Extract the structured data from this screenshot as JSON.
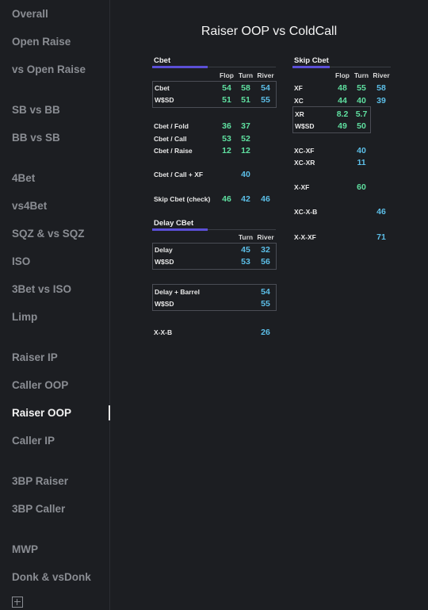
{
  "sidebar": {
    "items": [
      {
        "label": "Overall",
        "active": false
      },
      {
        "label": "Open Raise",
        "active": false
      },
      {
        "label": "vs Open Raise",
        "active": false
      },
      {
        "label": "SB vs BB",
        "active": false
      },
      {
        "label": "BB vs SB",
        "active": false
      },
      {
        "label": "4Bet",
        "active": false
      },
      {
        "label": "vs4Bet",
        "active": false
      },
      {
        "label": "SQZ & vs SQZ",
        "active": false
      },
      {
        "label": "ISO",
        "active": false
      },
      {
        "label": "3Bet vs ISO",
        "active": false
      },
      {
        "label": "Limp",
        "active": false
      },
      {
        "label": "Raiser IP",
        "active": false
      },
      {
        "label": "Caller OOP",
        "active": false
      },
      {
        "label": "Raiser OOP",
        "active": true
      },
      {
        "label": "Caller IP",
        "active": false
      },
      {
        "label": "3BP Raiser",
        "active": false
      },
      {
        "label": "3BP Caller",
        "active": false
      },
      {
        "label": "MWP",
        "active": false
      },
      {
        "label": "Donk & vsDonk",
        "active": false
      }
    ],
    "bottom_icon": "expand-icon"
  },
  "title": "Raiser OOP vs ColdCall",
  "colors": {
    "accent": "#5b4fd6",
    "green": "#5fe0a0",
    "blue": "#5cbfe8",
    "background": "#1c1e22"
  },
  "cbet": {
    "heading": "Cbet",
    "headers": [
      "Flop",
      "Turn",
      "River"
    ],
    "rows": [
      {
        "label": "Cbet",
        "values": [
          "54",
          "58",
          "54"
        ]
      },
      {
        "label": "W$SD",
        "values": [
          "51",
          "51",
          "55"
        ]
      },
      {
        "label": "Cbet / Fold",
        "values": [
          "36",
          "37",
          ""
        ]
      },
      {
        "label": "Cbet / Call",
        "values": [
          "53",
          "52",
          ""
        ]
      },
      {
        "label": "Cbet / Raise",
        "values": [
          "12",
          "12",
          ""
        ]
      },
      {
        "label": "Cbet / Call + XF",
        "values": [
          "",
          "40",
          ""
        ]
      },
      {
        "label": "Skip Cbet (check)",
        "values": [
          "46",
          "42",
          "46"
        ]
      }
    ]
  },
  "delay": {
    "heading": "Delay CBet",
    "headers": [
      "Turn",
      "River"
    ],
    "rows": [
      {
        "label": "Delay",
        "values": [
          "45",
          "32"
        ]
      },
      {
        "label": "W$SD",
        "values": [
          "53",
          "56"
        ]
      },
      {
        "label": "Delay + Barrel",
        "values": [
          "",
          "54"
        ]
      },
      {
        "label": "W$SD",
        "values": [
          "",
          "55"
        ]
      },
      {
        "label": "X-X-B",
        "values": [
          "",
          "26"
        ]
      }
    ]
  },
  "skip": {
    "heading": "Skip Cbet",
    "headers": [
      "Flop",
      "Turn",
      "River"
    ],
    "rows": [
      {
        "label": "XF",
        "values": [
          "48",
          "55",
          "58"
        ]
      },
      {
        "label": "XC",
        "values": [
          "44",
          "40",
          "39"
        ]
      },
      {
        "label": "XR",
        "values": [
          "8.2",
          "5.7",
          ""
        ]
      },
      {
        "label": "W$SD",
        "values": [
          "49",
          "50",
          ""
        ]
      },
      {
        "label": "XC-XF",
        "values": [
          "",
          "40",
          ""
        ]
      },
      {
        "label": "XC-XR",
        "values": [
          "",
          "11",
          ""
        ]
      },
      {
        "label": "X-XF",
        "values": [
          "",
          "60",
          ""
        ]
      },
      {
        "label": "XC-X-B",
        "values": [
          "",
          "",
          "46"
        ]
      },
      {
        "label": "X-X-XF",
        "values": [
          "",
          "",
          "71"
        ]
      }
    ]
  }
}
